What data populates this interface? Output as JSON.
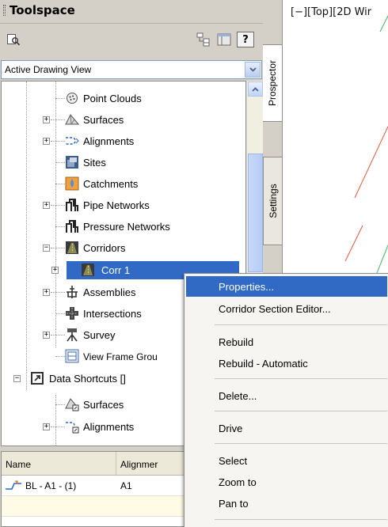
{
  "toolspace": {
    "title": "Toolspace",
    "view_selector": "Active Drawing View",
    "help_label": "?",
    "tabs": {
      "prospector": "Prospector",
      "settings": "Settings"
    },
    "tree": [
      {
        "label": "Point Clouds"
      },
      {
        "label": "Surfaces"
      },
      {
        "label": "Alignments"
      },
      {
        "label": "Sites"
      },
      {
        "label": "Catchments"
      },
      {
        "label": "Pipe Networks"
      },
      {
        "label": "Pressure Networks"
      },
      {
        "label": "Corridors"
      },
      {
        "label": "Corr 1"
      },
      {
        "label": "Assemblies"
      },
      {
        "label": "Intersections"
      },
      {
        "label": "Survey"
      },
      {
        "label": "View Frame Grou"
      },
      {
        "label": "Data Shortcuts []"
      },
      {
        "label": "Surfaces"
      },
      {
        "label": "Alignments"
      }
    ],
    "grid": {
      "headers": [
        "Name",
        "Alignmer"
      ],
      "rows": [
        {
          "name": "BL - A1 - (1)",
          "alignment": "A1"
        }
      ]
    }
  },
  "drawing": {
    "viewport_label": "[−][Top][2D Wir"
  },
  "context_menu": {
    "items": [
      "Properties...",
      "Corridor Section Editor...",
      "Rebuild",
      "Rebuild - Automatic",
      "Delete...",
      "Drive",
      "Select",
      "Zoom to",
      "Pan to"
    ]
  }
}
